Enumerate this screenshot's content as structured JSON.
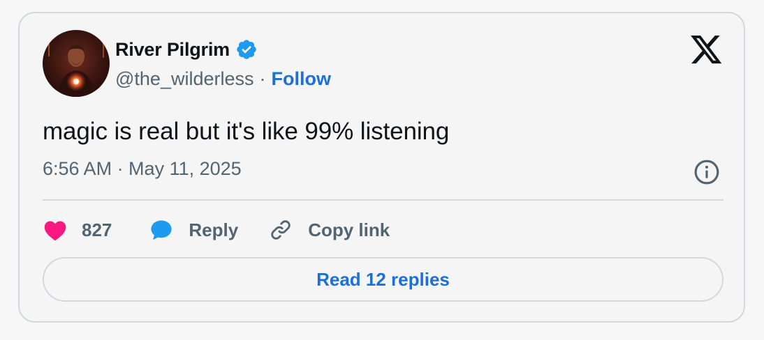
{
  "author": {
    "display_name": "River Pilgrim",
    "handle": "@the_wilderless",
    "separator": "·",
    "follow_label": "Follow",
    "verified": true
  },
  "tweet": {
    "text": "magic is real but it's like 99% listening",
    "timestamp": "6:56 AM · May 11, 2025"
  },
  "actions": {
    "like_count": "827",
    "reply_label": "Reply",
    "copy_link_label": "Copy link"
  },
  "read_replies_label": "Read 12 replies",
  "icons": {
    "logo": "x-logo-icon",
    "verified": "verified-badge-icon",
    "info": "info-icon",
    "like": "heart-icon",
    "reply": "speech-bubble-icon",
    "copy": "link-icon"
  },
  "colors": {
    "accent": "#1d6fd6",
    "like": "#f91880",
    "reply": "#1d9bf0",
    "text": "#0f1419",
    "muted": "#536471",
    "border": "#cfd9de"
  }
}
